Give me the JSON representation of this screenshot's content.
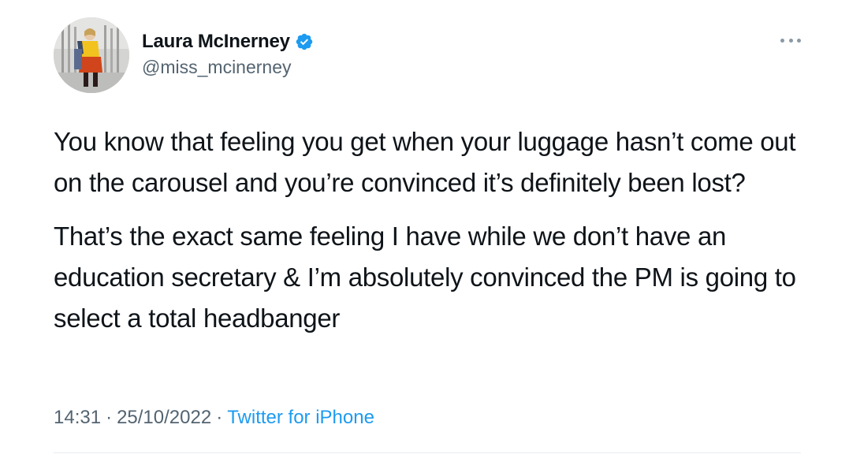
{
  "tweet": {
    "author": {
      "display_name": "Laura McInerney",
      "handle": "@miss_mcinerney",
      "verified": true,
      "verified_icon": "verified-badge-icon",
      "verified_color": "#1d9bf0"
    },
    "more_icon": "more-horizontal-icon",
    "paragraphs": [
      "You know that feeling you get when your luggage hasn’t come out on the carousel and you’re convinced it’s definitely been lost?",
      "That’s the exact same feeling I have while we don’t have an education secretary & I’m absolutely convinced the PM is going to select a total headbanger"
    ],
    "time": "14:31",
    "date": "25/10/2022",
    "separator": "·",
    "source": "Twitter for iPhone",
    "colors": {
      "text": "#0f1419",
      "secondary": "#536471",
      "link": "#1d9bf0"
    }
  }
}
